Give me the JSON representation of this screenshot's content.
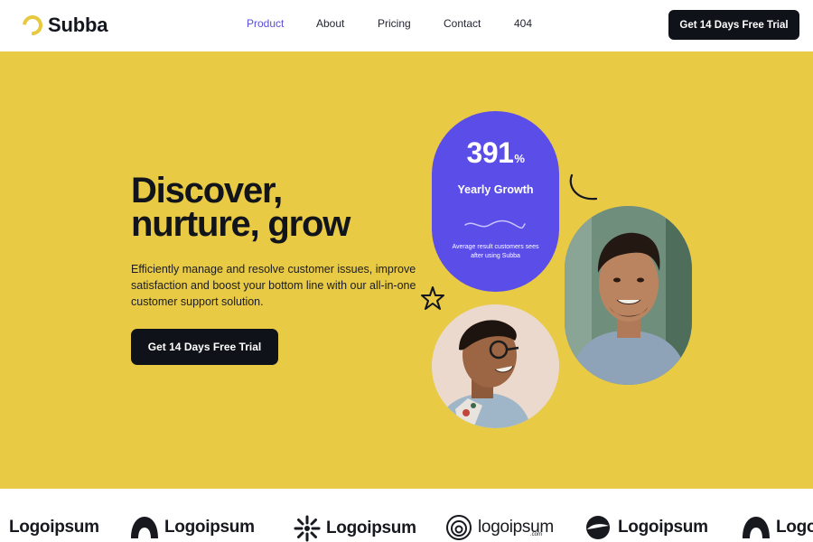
{
  "nav": {
    "brand": "Subba",
    "links": [
      {
        "label": "Product",
        "active": true
      },
      {
        "label": "About",
        "active": false
      },
      {
        "label": "Pricing",
        "active": false
      },
      {
        "label": "Contact",
        "active": false
      },
      {
        "label": "404",
        "active": false
      }
    ],
    "cta_label": "Get 14 Days Free Trial"
  },
  "hero": {
    "headline_line1": "Discover,",
    "headline_line2": "nurture, grow",
    "subtext": "Efficiently manage and resolve customer issues, improve satisfaction and boost your bottom line with our all-in-one customer support solution.",
    "cta_label": "Get 14 Days Free Trial",
    "stat": {
      "value": "391",
      "unit": "%",
      "label": "Yearly Growth",
      "note": "Average result customers sees after using Subba"
    }
  },
  "logos": {
    "items": [
      {
        "text": "Logoipsum",
        "icon": "half-circle-icon"
      },
      {
        "text": "Logoipsum",
        "icon": "arch-icon"
      },
      {
        "text": "Logoipsum",
        "icon": "sunburst-icon"
      },
      {
        "text": "logoipsum",
        "icon": "spiral-icon",
        "sub": ".com"
      },
      {
        "text": "Logoipsum",
        "icon": "swoosh-icon"
      },
      {
        "text": "Logo",
        "icon": "arch-icon"
      }
    ]
  },
  "colors": {
    "brand_yellow": "#e8ca45",
    "accent_purple": "#5b4de8",
    "active_link": "#5b4fd6",
    "dark": "#0f1218"
  }
}
